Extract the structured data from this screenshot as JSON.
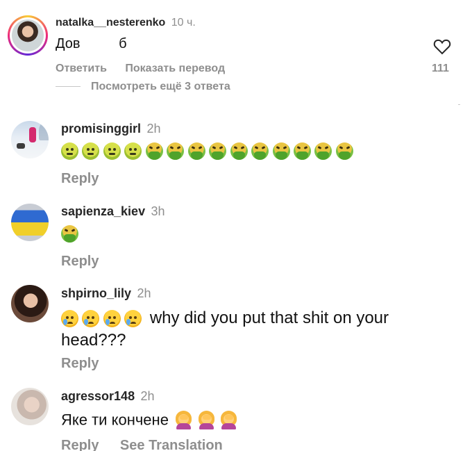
{
  "main_comment": {
    "username": "natalka__nesterenko",
    "time": "10 ч.",
    "text": "Дов          б",
    "reply_label": "Ответить",
    "translate_label": "Показать перевод",
    "likes": "111",
    "view_replies_label": "Посмотреть ещё 3 ответа"
  },
  "replies": [
    {
      "username": "promisinggirl",
      "time": "2h",
      "emojis": [
        "sick-face",
        "sick-face",
        "sick-face",
        "sick-face",
        "vomiting-face",
        "vomiting-face",
        "vomiting-face",
        "vomiting-face",
        "vomiting-face",
        "vomiting-face",
        "vomiting-face",
        "vomiting-face",
        "vomiting-face",
        "vomiting-face"
      ],
      "reply_label": "Reply"
    },
    {
      "username": "sapienza_kiev",
      "time": "3h",
      "emojis": [
        "vomiting-face"
      ],
      "reply_label": "Reply"
    },
    {
      "username": "shpirno_lily",
      "time": "2h",
      "emojis": [
        "crying-face",
        "crying-face",
        "crying-face",
        "crying-face"
      ],
      "text_line1": "why did you put that shit on your",
      "text_line2": "head???",
      "reply_label": "Reply"
    },
    {
      "username": "agressor148",
      "time": "2h",
      "text": "Яке ти кончене",
      "emojis": [
        "facepalm-woman",
        "facepalm-woman",
        "facepalm-woman"
      ],
      "reply_label": "Reply",
      "translate_label": "See Translation"
    }
  ]
}
